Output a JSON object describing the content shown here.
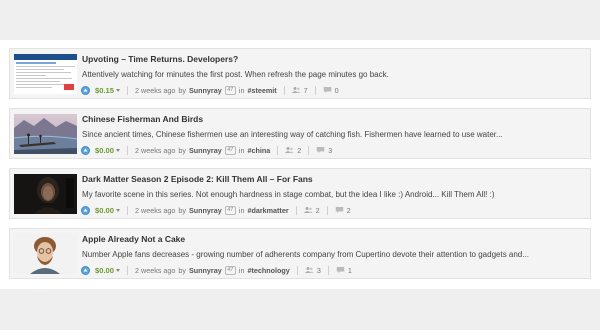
{
  "posts": [
    {
      "title": "Upvoting – Time Returns. Developers?",
      "body": "Attentively watching for minutes the first post. When refresh the page minutes go back.",
      "payout": "$0.15",
      "time": "2 weeks ago",
      "by": "by",
      "author": "Sunnyray",
      "reputation": "47",
      "in": "in",
      "tag": "#steemit",
      "votes": "7",
      "comments": "0",
      "thumbnail": "screenshot-thumbnail"
    },
    {
      "title": "Chinese Fisherman And Birds",
      "body": "Since ancient times, Chinese fishermen use an interesting way of catching fish. Fishermen have learned to use water...",
      "payout": "$0.00",
      "time": "2 weeks ago",
      "by": "by",
      "author": "Sunnyray",
      "reputation": "47",
      "in": "in",
      "tag": "#china",
      "votes": "2",
      "comments": "3",
      "thumbnail": "river-landscape-thumbnail"
    },
    {
      "title": "Dark Matter Season 2 Episode 2: Kill Them All – For Fans",
      "body": "My favorite scene in this series. Not enough hardness in stage combat, but the idea I like :) Android... Kill Them All! :)",
      "payout": "$0.00",
      "time": "2 weeks ago",
      "by": "by",
      "author": "Sunnyray",
      "reputation": "47",
      "in": "in",
      "tag": "#darkmatter",
      "votes": "2",
      "comments": "2",
      "thumbnail": "dark-portrait-thumbnail"
    },
    {
      "title": "Apple Already Not a Cake",
      "body": "Number Apple fans decreases - growing number of adherents company from Cupertino devote their attention to gadgets and...",
      "payout": "$0.00",
      "time": "2 weeks ago",
      "by": "by",
      "author": "Sunnyray",
      "reputation": "47",
      "in": "in",
      "tag": "#technology",
      "votes": "3",
      "comments": "1",
      "thumbnail": "bearded-man-thumbnail"
    }
  ],
  "colors": {
    "payout_green": "#6b9a2c",
    "vote_blue": "#5aa3de",
    "band_gray": "#efefef",
    "card_bg": "#f4f4f4"
  },
  "icons": {
    "upvote": "upvote-icon",
    "dropdown": "chevron-down-icon",
    "voters": "voters-icon",
    "comments": "comment-icon"
  }
}
